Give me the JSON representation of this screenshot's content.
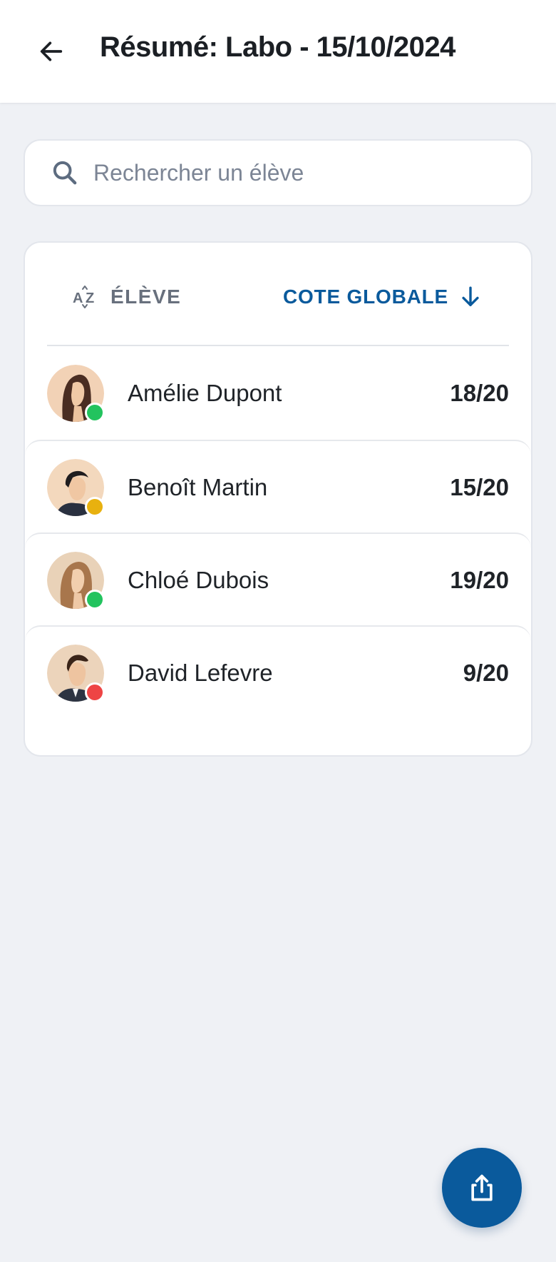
{
  "header": {
    "title": "Résumé: Labo - 15/10/2024",
    "back_icon": "arrow-left-icon"
  },
  "search": {
    "placeholder": "Rechercher un élève",
    "value": "",
    "icon": "search-icon"
  },
  "table": {
    "sort_name_label": "ÉLÈVE",
    "sort_name_icon": "sort-alpha-icon",
    "sort_grade_label": "COTE GLOBALE",
    "sort_grade_icon": "arrow-down-icon",
    "accent_color": "#0a5a9c",
    "students": [
      {
        "name": "Amélie Dupont",
        "grade": "18/20",
        "status_color": "#22c35e"
      },
      {
        "name": "Benoît Martin",
        "grade": "15/20",
        "status_color": "#e8b10f"
      },
      {
        "name": "Chloé Dubois",
        "grade": "19/20",
        "status_color": "#22c35e"
      },
      {
        "name": "David Lefevre",
        "grade": "9/20",
        "status_color": "#ee4444"
      }
    ]
  },
  "fab": {
    "icon": "share-icon",
    "color": "#0a5a9c"
  }
}
